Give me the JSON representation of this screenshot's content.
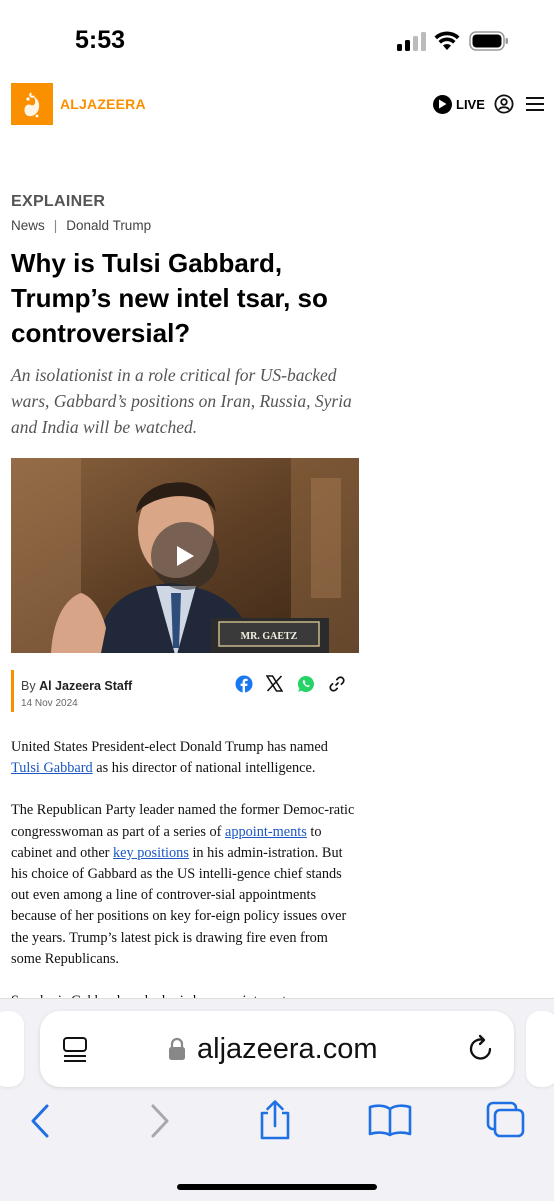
{
  "status_bar": {
    "time": "5:53"
  },
  "header": {
    "logo_text": "ALJAZEERA",
    "live_label": "LIVE"
  },
  "article": {
    "kicker": "EXPLAINER",
    "breadcrumbs": [
      "News",
      "Donald Trump"
    ],
    "title": "Why is Tulsi Gabbard, Trump’s new intel tsar, so controversial?",
    "subtitle": "An isolationist in a role critical for US-backed wars, Gabbard’s positions on Iran, Russia, Syria and India will be watched.",
    "image_caption_sign": "MR. GAETZ",
    "byline_prefix": "By",
    "author": "Al Jazeera Staff",
    "date": "14 Nov 2024",
    "p1_a": "United States President-elect Donald Trump has named ",
    "p1_link": "Tulsi Gabbard",
    "p1_b": " as his director of national intelligence.",
    "p2_a": "The Republican Party leader named the former Democ-ratic congresswoman as part of a series of ",
    "p2_link1": "appoint-ments",
    "p2_b": " to cabinet and other ",
    "p2_link2": "key positions",
    "p2_c": " in his admin-istration. But his choice of Gabbard as the US intelli-gence chief stands out even among a line of controver-sial appointments because of her positions on key for-eign policy issues over the years. Trump’s latest pick is drawing fire even from some Republicans.",
    "p3": "So who is Gabbard, and why is her appointment so con-"
  },
  "browser": {
    "domain": "aljazeera.com"
  },
  "colors": {
    "brand": "#fa9000",
    "link": "#1a56c4",
    "ios_blue": "#1f6fe5"
  }
}
